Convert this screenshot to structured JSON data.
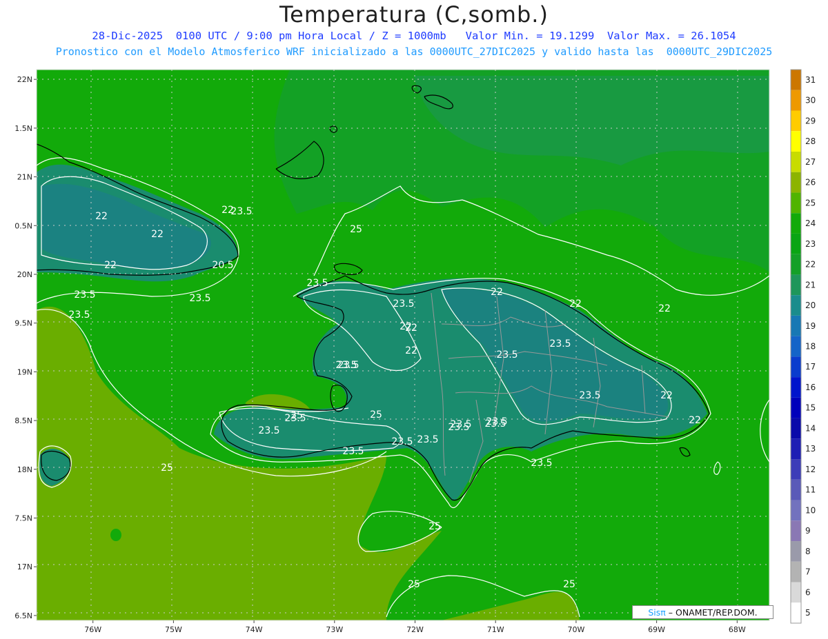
{
  "title": "Temperatura (C,somb.)",
  "subtitle": {
    "date": "28-Dic-2025",
    "utc_time": "0100 UTC",
    "local_time": "9:00 pm Hora Local",
    "level": "Z = 1000mb",
    "min_label": "Valor Min. =",
    "min_value": "19.1299",
    "max_label": "Valor Max. =",
    "max_value": "26.1054",
    "line1": "28-Dic-2025  0100 UTC / 9:00 pm Hora Local / Z = 1000mb   Valor Min. = 19.1299  Valor Max. = 26.1054",
    "line2": "Pronostico con el Modelo Atmosferico WRF inicializado a las 0000UTC_27DIC2025 y valido hasta las  0000UTC_29DIC2025"
  },
  "credit": {
    "brand": "Sisπ",
    "text": " – ONAMET/REP.DOM."
  },
  "chart_data": {
    "type": "heatmap",
    "variable": "Temperatura",
    "units": "C",
    "level": "1000mb",
    "x_axis": {
      "range": [
        -76.7,
        -67.6
      ],
      "ticks": [
        "76W",
        "75W",
        "74W",
        "73W",
        "72W",
        "71W",
        "70W",
        "69W",
        "68W"
      ]
    },
    "y_axis": {
      "range": [
        16.45,
        22.1
      ],
      "ticks": [
        "22N",
        "1.5N",
        "21N",
        "0.5N",
        "20N",
        "9.5N",
        "19N",
        "8.5N",
        "18N",
        "7.5N",
        "17N",
        "6.5N"
      ]
    },
    "colorbar": {
      "levels": [
        5,
        6,
        7,
        8,
        9,
        10,
        11,
        12,
        13,
        14,
        15,
        16,
        17,
        18,
        19,
        20,
        21,
        22,
        23,
        24,
        25,
        26,
        27,
        28,
        29,
        30,
        31
      ],
      "colors": [
        "#ffffff",
        "#d9d9d9",
        "#b3b3b3",
        "#9a9aaa",
        "#8a78b4",
        "#7272be",
        "#5a5ab8",
        "#3c3cb8",
        "#1e1eb4",
        "#0a0aaa",
        "#0000bb",
        "#0014cc",
        "#0a3ccd",
        "#1464c8",
        "#1778b4",
        "#1a8c8c",
        "#1e965a",
        "#14a028",
        "#0aa514",
        "#12aa0a",
        "#50b400",
        "#8cb400",
        "#c8dc00",
        "#ffff00",
        "#ffcc00",
        "#ee9900",
        "#cc7700"
      ]
    },
    "contour_labels": [
      "22",
      "22",
      "20.5",
      "22",
      "22",
      "23.5",
      "23.5",
      "23.5",
      "23.5",
      "25",
      "23.5",
      "23.5",
      "22",
      "22",
      "22",
      "22",
      "23.5",
      "23.5",
      "23.5",
      "22",
      "22",
      "22",
      "22",
      "23.5",
      "23.5",
      "23.5",
      "23.5",
      "23.5",
      "25",
      "23.5",
      "25",
      "23.5",
      "23.5",
      "23.5",
      "23.5",
      "25",
      "25",
      "25",
      "25",
      "23.5",
      "23.5"
    ],
    "value_min": 19.1299,
    "value_max": 26.1054
  }
}
